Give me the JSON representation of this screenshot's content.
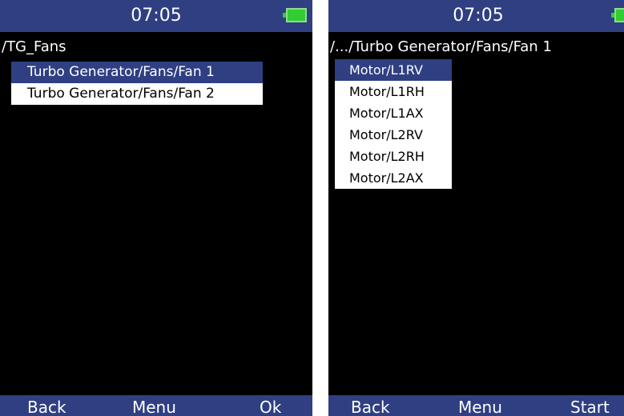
{
  "left_screen": {
    "clock": "07:05",
    "battery_icon": "battery-full-icon",
    "path": "/TG_Fans",
    "items": [
      {
        "label": "Turbo Generator/Fans/Fan 1",
        "selected": true
      },
      {
        "label": "Turbo Generator/Fans/Fan 2",
        "selected": false
      }
    ],
    "soft_keys": {
      "left": "Back",
      "center": "Menu",
      "right": "Ok"
    }
  },
  "right_screen": {
    "clock": "07:05",
    "battery_icon": "battery-full-icon",
    "path": "/.../Turbo Generator/Fans/Fan 1",
    "items": [
      {
        "label": "Motor/L1RV",
        "selected": true
      },
      {
        "label": "Motor/L1RH",
        "selected": false
      },
      {
        "label": "Motor/L1AX",
        "selected": false
      },
      {
        "label": "Motor/L2RV",
        "selected": false
      },
      {
        "label": "Motor/L2RH",
        "selected": false
      },
      {
        "label": "Motor/L2AX",
        "selected": false
      }
    ],
    "soft_keys": {
      "left": "Back",
      "center": "Menu",
      "right": "Start"
    }
  },
  "colors": {
    "bar_blue": "#2f3f82",
    "battery_green": "#33cc33",
    "screen_bg": "#000000",
    "item_bg": "#ffffff"
  }
}
